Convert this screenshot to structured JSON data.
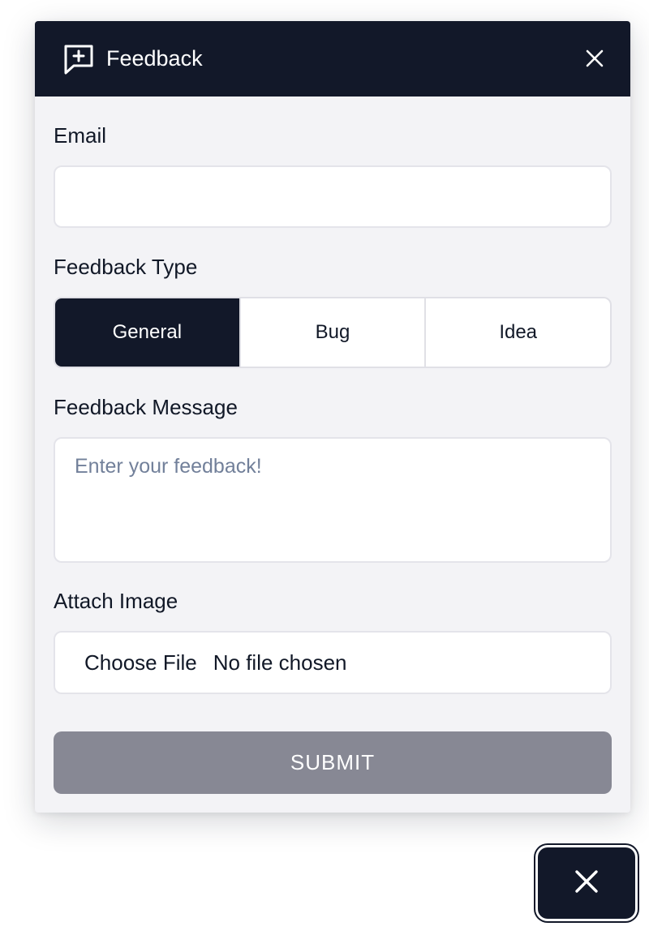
{
  "header": {
    "title": "Feedback",
    "icon": "message-plus-icon",
    "close_icon": "close-icon"
  },
  "form": {
    "email_label": "Email",
    "email_value": "",
    "email_placeholder": "",
    "type_label": "Feedback Type",
    "types": [
      {
        "label": "General",
        "selected": true
      },
      {
        "label": "Bug",
        "selected": false
      },
      {
        "label": "Idea",
        "selected": false
      }
    ],
    "message_label": "Feedback Message",
    "message_placeholder": "Enter your feedback!",
    "attach_label": "Attach Image",
    "choose_file_label": "Choose File",
    "file_status": "No file chosen",
    "submit_label": "SUBMIT"
  },
  "launcher": {
    "icon": "close-icon"
  },
  "colors": {
    "header_bg": "#121829",
    "panel_bg": "#f3f3f6",
    "submit_bg": "#878894",
    "placeholder": "#72809a"
  }
}
